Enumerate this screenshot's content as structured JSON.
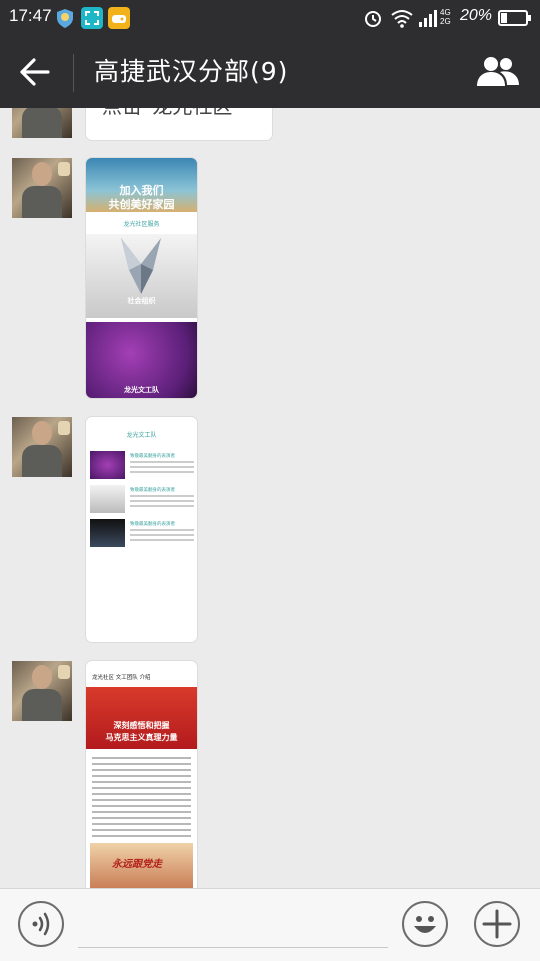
{
  "status_bar": {
    "time": "17:47",
    "battery_percent": "20%",
    "network": "4G",
    "network2": "2G",
    "icons": [
      "shield-app-icon",
      "scan-app-icon",
      "game-app-icon",
      "alarm-icon",
      "wifi-icon",
      "signal-icon",
      "battery-icon"
    ]
  },
  "header": {
    "title": "高捷武汉分部(9)",
    "back_icon": "arrow-left-icon",
    "members_icon": "group-members-icon"
  },
  "messages": {
    "previous_text": "点击“龙光社区”",
    "card1": {
      "heading_line1": "加入我们",
      "heading_line2": "共创美好家园",
      "logo_text": "龙光社区服务",
      "item1_caption": "社会组织",
      "item2_caption": "龙光文工队"
    },
    "card2": {
      "logo_text": "龙光文工队",
      "item1_title": "致敬最美翻身的表演者",
      "item2_title": "致敬最美翻身的表演者",
      "item3_title": "致敬最美翻身的表演者"
    },
    "card3": {
      "header": "龙光社区 文工团队 介绍",
      "banner_line1": "深刻感悟和把握",
      "banner_line2": "马克思主义真理力量",
      "image_caption": "永远跟党走"
    }
  },
  "input_bar": {
    "voice_icon": "voice-input-icon",
    "emoji_icon": "emoji-icon",
    "plus_icon": "plus-icon"
  }
}
